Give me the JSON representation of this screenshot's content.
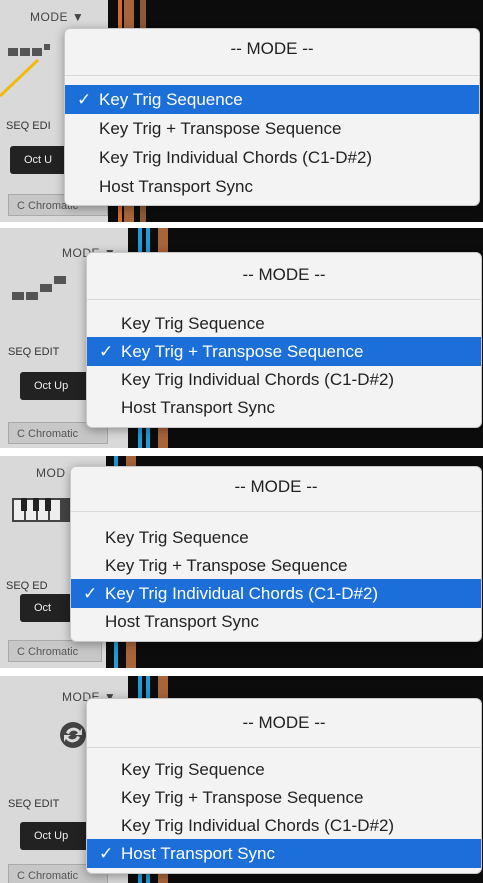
{
  "screens": [
    {
      "mode_label": "MODE",
      "mode_arrow": "▼",
      "seq_label": "SEQ EDI",
      "oct_label": "Oct U",
      "scale_label": "C Chromatic",
      "icon": "sequence-steps-icon",
      "menu": {
        "title": "-- MODE --",
        "items": [
          "Key Trig Sequence",
          "Key Trig + Transpose Sequence",
          "Key Trig Individual Chords (C1-D#2)",
          "Host Transport Sync"
        ],
        "selected": 0
      }
    },
    {
      "mode_label": "MODE",
      "mode_arrow": "▼",
      "seq_label": "SEQ EDIT",
      "oct_label": "Oct Up",
      "scale_label": "C Chromatic",
      "icon": "transpose-steps-icon",
      "menu": {
        "title": "-- MODE --",
        "items": [
          "Key Trig Sequence",
          "Key Trig + Transpose Sequence",
          "Key Trig Individual Chords (C1-D#2)",
          "Host Transport Sync"
        ],
        "selected": 1
      }
    },
    {
      "mode_label": "MOD",
      "mode_arrow": "",
      "seq_label": "SEQ ED",
      "oct_label": "Oct",
      "scale_label": "C Chromatic",
      "icon": "piano-keys-icon",
      "menu": {
        "title": "-- MODE --",
        "items": [
          "Key Trig Sequence",
          "Key Trig + Transpose Sequence",
          "Key Trig Individual Chords (C1-D#2)",
          "Host Transport Sync"
        ],
        "selected": 2
      }
    },
    {
      "mode_label": "MODE",
      "mode_arrow": "▼",
      "seq_label": "SEQ EDIT",
      "oct_label": "Oct Up",
      "scale_label": "C Chromatic",
      "icon": "sync-icon",
      "menu": {
        "title": "-- MODE --",
        "items": [
          "Key Trig Sequence",
          "Key Trig + Transpose Sequence",
          "Key Trig Individual Chords (C1-D#2)",
          "Host Transport Sync"
        ],
        "selected": 3
      }
    }
  ],
  "checkmark": "✓",
  "colors": {
    "selection": "#1c6fd9",
    "arrow": "#f2b90f",
    "track_blue": "#1e9bd8",
    "track_wood": "#a8643a"
  }
}
